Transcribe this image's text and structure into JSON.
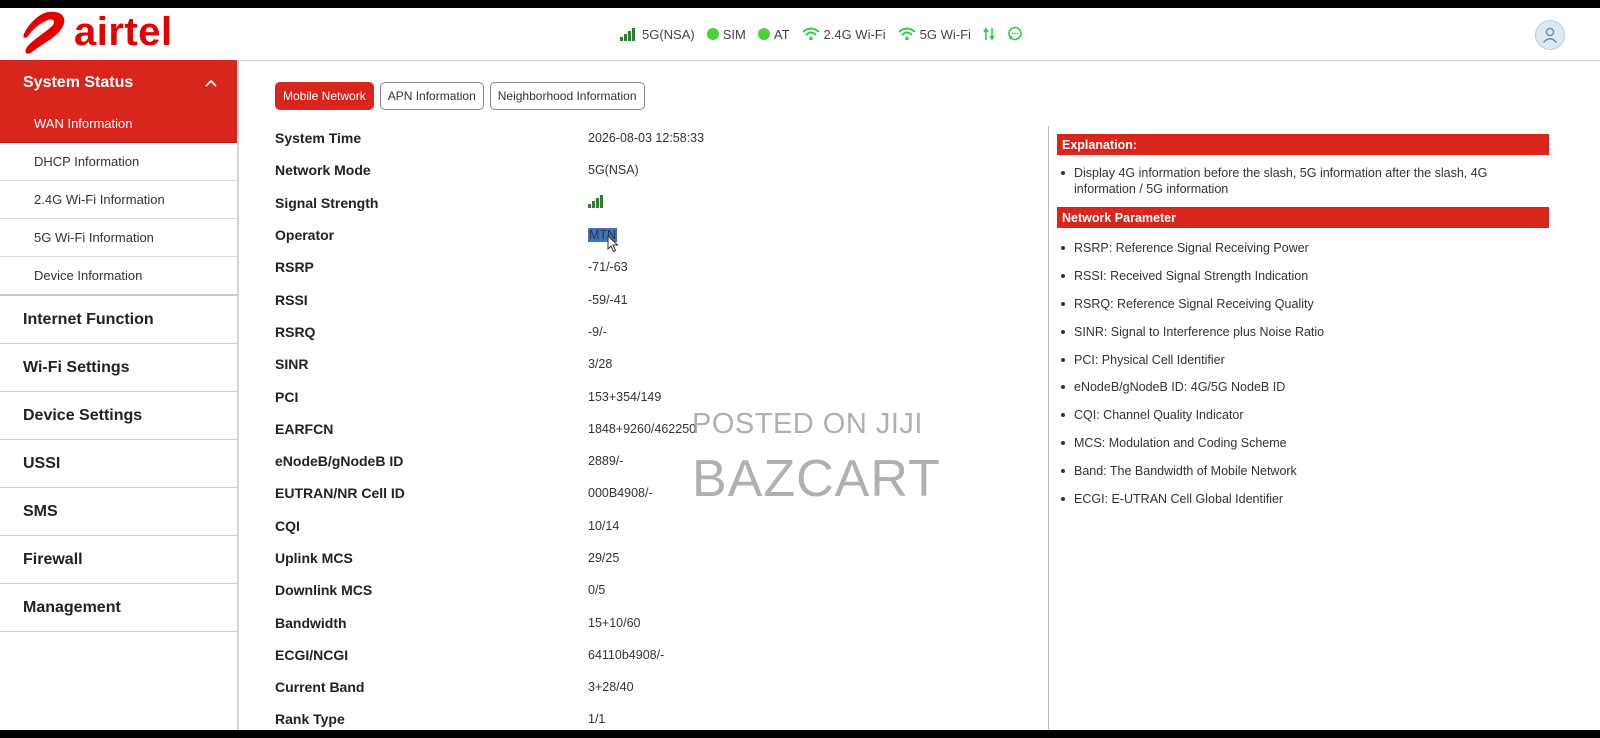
{
  "header": {
    "brand": "airtel",
    "status": [
      {
        "type": "signal",
        "label": "5G(NSA)"
      },
      {
        "type": "dot",
        "label": "SIM"
      },
      {
        "type": "dot",
        "label": "AT"
      },
      {
        "type": "wifi",
        "label": "2.4G Wi-Fi"
      },
      {
        "type": "wifi",
        "label": "5G Wi-Fi"
      }
    ],
    "colors": {
      "brand": "#e40000",
      "accent": "#d8261c",
      "ok": "#4cd137",
      "wifi": "#2ecc40"
    }
  },
  "sidebar": {
    "section": "System Status",
    "sub_items": [
      "WAN Information",
      "DHCP Information",
      "2.4G Wi-Fi Information",
      "5G Wi-Fi Information",
      "Device Information"
    ],
    "menu_items": [
      "Internet Function",
      "Wi-Fi Settings",
      "Device Settings",
      "USSI",
      "SMS",
      "Firewall",
      "Management"
    ]
  },
  "tabs": [
    "Mobile Network",
    "APN Information",
    "Neighborhood Information"
  ],
  "info": {
    "labels": [
      "System Time",
      "Network Mode",
      "Signal Strength",
      "Operator",
      "RSRP",
      "RSSI",
      "RSRQ",
      "SINR",
      "PCI",
      "EARFCN",
      "eNodeB/gNodeB ID",
      "EUTRAN/NR Cell ID",
      "CQI",
      "Uplink MCS",
      "Downlink MCS",
      "Bandwidth",
      "ECGI/NCGI",
      "Current Band",
      "Rank Type"
    ],
    "values": [
      "2026-08-03 12:58:33",
      "5G(NSA)",
      "",
      "MTN",
      "-71/-63",
      "-59/-41",
      "-9/-",
      "3/28",
      "153+354/149",
      "1848+9260/462250",
      "2889/-",
      "000B4908/-",
      "10/14",
      "29/25",
      "0/5",
      "15+10/60",
      "64110b4908/-",
      "3+28/40",
      "1/1"
    ]
  },
  "right": {
    "explanation_title": "Explanation:",
    "explanation_text": "Display 4G information before the slash, 5G information after the slash, 4G information / 5G information",
    "param_title": "Network Parameter",
    "params": [
      "RSRP: Reference Signal Receiving Power",
      "RSSI: Received Signal Strength Indication",
      "RSRQ: Reference Signal Receiving Quality",
      "SINR: Signal to Interference plus Noise Ratio",
      "PCI: Physical Cell Identifier",
      "eNodeB/gNodeB ID: 4G/5G NodeB ID",
      "CQI: Channel Quality Indicator",
      "MCS: Modulation and Coding Scheme",
      "Band: The Bandwidth of Mobile Network",
      "ECGI: E-UTRAN Cell Global Identifier"
    ]
  },
  "watermark": {
    "line1": "POSTED ON JIJI",
    "line2": "BAZCART"
  }
}
